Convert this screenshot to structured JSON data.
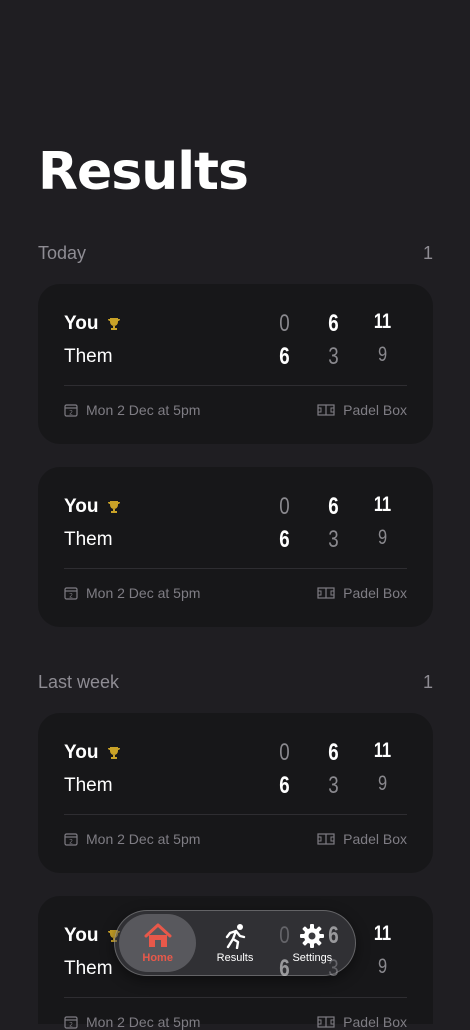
{
  "page": {
    "title": "Results"
  },
  "sections": [
    {
      "label": "Today",
      "count": "1"
    },
    {
      "label": "Last week",
      "count": "1"
    }
  ],
  "matches": [
    {
      "you_label": "You",
      "them_label": "Them",
      "you_scores": [
        "0",
        "6",
        "11"
      ],
      "them_scores": [
        "6",
        "3",
        "9"
      ],
      "date": "Mon 2 Dec at 5pm",
      "venue": "Padel Box"
    },
    {
      "you_label": "You",
      "them_label": "Them",
      "you_scores": [
        "0",
        "6",
        "11"
      ],
      "them_scores": [
        "6",
        "3",
        "9"
      ],
      "date": "Mon 2 Dec at 5pm",
      "venue": "Padel Box"
    },
    {
      "you_label": "You",
      "them_label": "Them",
      "you_scores": [
        "0",
        "6",
        "11"
      ],
      "them_scores": [
        "6",
        "3",
        "9"
      ],
      "date": "Mon 2 Dec at 5pm",
      "venue": "Padel Box"
    },
    {
      "you_label": "You",
      "them_label": "Them",
      "you_scores": [
        "0",
        "6",
        "11"
      ],
      "them_scores": [
        "6",
        "3",
        "9"
      ],
      "date": "Mon 2 Dec at 5pm",
      "venue": "Padel Box"
    }
  ],
  "calendar_day": "2",
  "tabbar": {
    "home": "Home",
    "results": "Results",
    "settings": "Settings"
  },
  "colors": {
    "background": "#1f1e22",
    "card": "#171719",
    "accent": "#e8584a",
    "trophy": "#c9a227"
  },
  "icons": [
    "trophy-icon",
    "calendar-icon",
    "court-icon",
    "home-icon",
    "running-icon",
    "gear-icon"
  ]
}
